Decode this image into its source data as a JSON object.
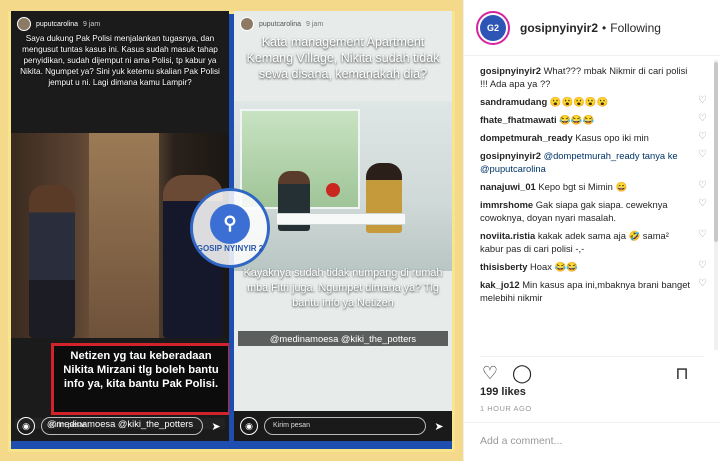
{
  "stories": {
    "left": {
      "user": "puputcarolina",
      "time": "9 jam",
      "caption": "Saya dukung Pak Polisi menjalankan tugasnya, dan mengusut tuntas kasus ini. Kasus sudah masuk tahap penyidikan, sudah dijemput ni ama Polisi, tp kabur ya Nikita. Ngumpet ya? Sini yuk ketemu skalian Pak Polisi jemput u ni. Lagi dimana kamu Lampir?",
      "box_text": "Netizen yg tau keberadaan Nikita Mirzani tlg boleh bantu info ya, kita bantu Pak Polisi.",
      "mention": "@medinamoesa @kiki_the_potters",
      "message_placeholder": "Kirim pesan"
    },
    "right": {
      "user": "puputcarolina",
      "time": "9 jam",
      "caption_top": "Kata management Apartment Kemang Village, Nikita sudah tidak sewa disana, kemanakah dia?",
      "caption_bottom": "Kayaknya sudah tidak numpang di rumah mba Fitri juga. Ngumpet dimana ya? Tlg bantu info ya Netizen",
      "mention": "@medinamoesa @kiki_the_potters",
      "message_placeholder": "Kirim pesan"
    },
    "watermark_text": "GOSIP NYINYIR 2"
  },
  "post": {
    "username": "gosipnyinyir2",
    "follow_status": "Following",
    "likes": "199 likes",
    "time": "1 HOUR AGO",
    "add_comment_placeholder": "Add a comment..."
  },
  "comments": [
    {
      "user": "gosipnyinyir2",
      "text": "What??? mbak Nikmir di cari polisi !!! Ada apa ya ??",
      "heart": false
    },
    {
      "user": "sandramudang",
      "text": "😮😮😮😮😮",
      "heart": true
    },
    {
      "user": "fhate_fhatmawati",
      "text": "😂😂😂",
      "heart": true
    },
    {
      "user": "dompetmurah_ready",
      "text": "Kasus opo iki min",
      "heart": true
    },
    {
      "user": "gosipnyinyir2",
      "text": "@dompetmurah_ready tanya ke @puputcarolina",
      "heart": true
    },
    {
      "user": "nanajuwi_01",
      "text": "Kepo bgt si Mimin 😄",
      "heart": true
    },
    {
      "user": "immrshome",
      "text": "Gak siapa gak siapa. ceweknya cowoknya, doyan nyari masalah.",
      "heart": true
    },
    {
      "user": "noviita.ristia",
      "text": "kakak adek sama aja 🤣 sama² kabur pas di cari polisi -,-",
      "heart": true
    },
    {
      "user": "thisisberty",
      "text": "Hoax 😂😂",
      "heart": true
    },
    {
      "user": "kak_jo12",
      "text": "Min kasus apa ini,mbaknya brani banget melebihi nikmir",
      "heart": true
    }
  ]
}
